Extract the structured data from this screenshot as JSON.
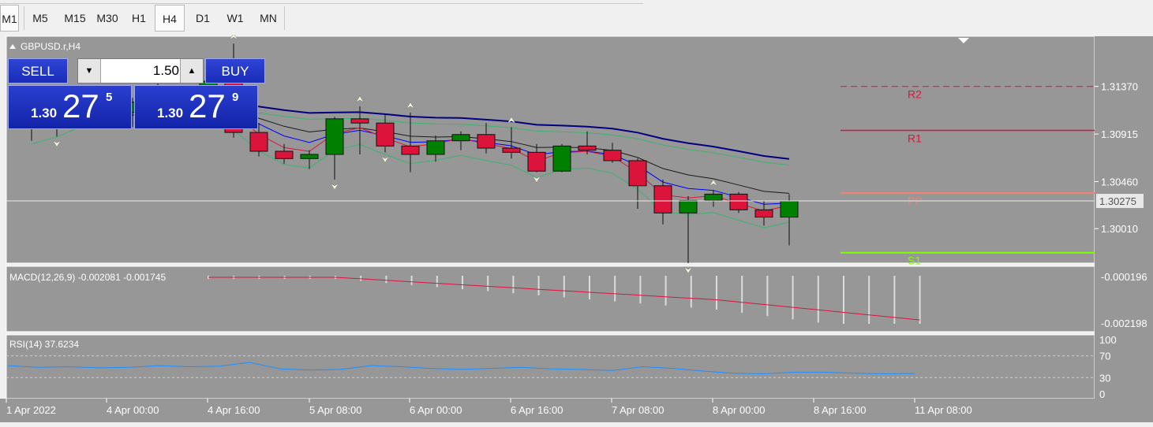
{
  "toolbar": {
    "timeframes": [
      {
        "label": "M1",
        "active": true
      },
      {
        "label": "M5",
        "active": false
      },
      {
        "label": "M15",
        "active": false
      },
      {
        "label": "M30",
        "active": false
      },
      {
        "label": "H1",
        "active": false
      },
      {
        "label": "H4",
        "active": true
      },
      {
        "label": "D1",
        "active": false
      },
      {
        "label": "W1",
        "active": false
      },
      {
        "label": "MN",
        "active": false
      }
    ]
  },
  "trade_panel": {
    "sell_label": "SELL",
    "buy_label": "BUY",
    "lot_value": "1.50",
    "sell_price": {
      "small": "1.30",
      "big": "27",
      "pip": "5"
    },
    "buy_price": {
      "small": "1.30",
      "big": "27",
      "pip": "9"
    }
  },
  "chart_data": {
    "type": "candlestick",
    "symbol_label": "GBPUSD.r,H4",
    "y_ticks": [
      "1.31370",
      "1.30915",
      "1.30460",
      "1.30010"
    ],
    "current_price_label": "1.30275",
    "current_price": 1.30275,
    "pivot_labels": {
      "r2": "R2",
      "r1": "R1",
      "pp": "PP",
      "s1": "S1"
    },
    "pivots": {
      "r2": 1.3137,
      "r1": 1.3095,
      "pp": 1.3035,
      "s1": 1.2978
    },
    "ylim": [
      1.2968,
      1.3185
    ],
    "x_labels": [
      "1 Apr 2022",
      "4 Apr 00:00",
      "4 Apr 16:00",
      "5 Apr 08:00",
      "6 Apr 00:00",
      "6 Apr 16:00",
      "7 Apr 08:00",
      "8 Apr 00:00",
      "8 Apr 16:00",
      "11 Apr 08:00"
    ],
    "candles": [
      {
        "o": 1.3103,
        "h": 1.3115,
        "l": 1.3085,
        "c": 1.3098
      },
      {
        "o": 1.3098,
        "h": 1.3118,
        "l": 1.3089,
        "c": 1.311
      },
      {
        "o": 1.311,
        "h": 1.3128,
        "l": 1.31,
        "c": 1.3124
      },
      {
        "o": 1.3124,
        "h": 1.3136,
        "l": 1.3108,
        "c": 1.3112
      },
      {
        "o": 1.3112,
        "h": 1.3126,
        "l": 1.3098,
        "c": 1.3122
      },
      {
        "o": 1.3122,
        "h": 1.314,
        "l": 1.3112,
        "c": 1.3116
      },
      {
        "o": 1.3116,
        "h": 1.313,
        "l": 1.3106,
        "c": 1.3128
      },
      {
        "o": 1.3128,
        "h": 1.315,
        "l": 1.3118,
        "c": 1.3142
      },
      {
        "o": 1.3142,
        "h": 1.3178,
        "l": 1.3088,
        "c": 1.3093
      },
      {
        "o": 1.3093,
        "h": 1.3102,
        "l": 1.307,
        "c": 1.3075
      },
      {
        "o": 1.3075,
        "h": 1.3082,
        "l": 1.3063,
        "c": 1.3068
      },
      {
        "o": 1.3068,
        "h": 1.3076,
        "l": 1.3058,
        "c": 1.3072
      },
      {
        "o": 1.3072,
        "h": 1.3108,
        "l": 1.3048,
        "c": 1.3106
      },
      {
        "o": 1.3106,
        "h": 1.3118,
        "l": 1.3072,
        "c": 1.3102
      },
      {
        "o": 1.3102,
        "h": 1.311,
        "l": 1.3074,
        "c": 1.308
      },
      {
        "o": 1.308,
        "h": 1.3112,
        "l": 1.3055,
        "c": 1.3072
      },
      {
        "o": 1.3072,
        "h": 1.309,
        "l": 1.3065,
        "c": 1.3085
      },
      {
        "o": 1.3085,
        "h": 1.3094,
        "l": 1.3076,
        "c": 1.3091
      },
      {
        "o": 1.3091,
        "h": 1.3102,
        "l": 1.3073,
        "c": 1.3078
      },
      {
        "o": 1.3078,
        "h": 1.3098,
        "l": 1.3068,
        "c": 1.3074
      },
      {
        "o": 1.3074,
        "h": 1.3082,
        "l": 1.3055,
        "c": 1.3056
      },
      {
        "o": 1.3056,
        "h": 1.3082,
        "l": 1.3055,
        "c": 1.308
      },
      {
        "o": 1.308,
        "h": 1.3094,
        "l": 1.3072,
        "c": 1.3076
      },
      {
        "o": 1.3076,
        "h": 1.3083,
        "l": 1.3064,
        "c": 1.3066
      },
      {
        "o": 1.3066,
        "h": 1.3068,
        "l": 1.302,
        "c": 1.3042
      },
      {
        "o": 1.3042,
        "h": 1.3048,
        "l": 1.3005,
        "c": 1.3016
      },
      {
        "o": 1.3016,
        "h": 1.3032,
        "l": 1.2968,
        "c": 1.3028
      },
      {
        "o": 1.3028,
        "h": 1.3038,
        "l": 1.3022,
        "c": 1.3034
      },
      {
        "o": 1.3034,
        "h": 1.3036,
        "l": 1.3016,
        "c": 1.3019
      },
      {
        "o": 1.3019,
        "h": 1.3028,
        "l": 1.3004,
        "c": 1.3012
      },
      {
        "o": 1.3012,
        "h": 1.3034,
        "l": 1.2985,
        "c": 1.30275
      }
    ],
    "macd_label": "MACD(12,26,9) -0.002081 -0.001745",
    "macd_ticks": [
      "-0.000196",
      "-0.002198"
    ],
    "rsi_label": "RSI(14) 37.6234",
    "rsi_ticks": [
      "100",
      "70",
      "30",
      "0"
    ],
    "colors": {
      "background": "#979797",
      "bull": "#008000",
      "bear": "#dc143c",
      "ma_fast": "#0000ff",
      "ma_slow": "#000080",
      "bands": "#3cb371",
      "r_line": "#dc143c",
      "pp_line": "#fa8072",
      "s_line": "#7fff00",
      "macd_signal": "#dc143c",
      "rsi": "#1e90ff"
    }
  }
}
